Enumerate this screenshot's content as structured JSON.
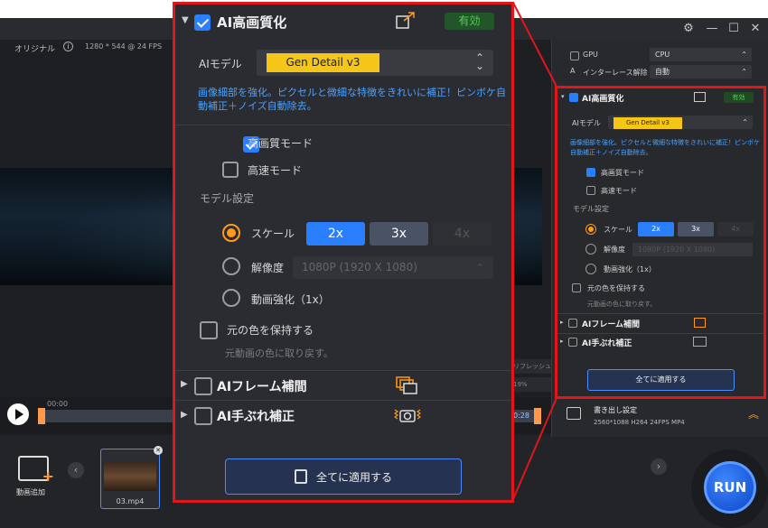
{
  "preview": {
    "original_label": "オリジナル",
    "video_info": "1280 * 544 @ 24 FPS",
    "time_start": "00:00",
    "time_end": "0:28"
  },
  "bottom": {
    "add_video_label": "動画追加",
    "clip_name": "03.mp4",
    "run_label": "RUN"
  },
  "right_panel": {
    "gpu_label": "GPU",
    "gpu_value": "CPU",
    "interlace_label": "インターレース解除",
    "interlace_value": "自動",
    "upscale_title": "AI高画質化",
    "upscale_status": "有効",
    "model_label": "AIモデル",
    "model_value": "Gen Detail v3",
    "description": "画像細部を強化。ピクセルと微細な特徴をきれいに補正！ピンボケ自動補正＋ノイズ自動除去。",
    "hq_mode": "高画質モード",
    "fast_mode": "高速モード",
    "model_settings": "モデル設定",
    "scale_label": "スケール",
    "scale_options": [
      "2x",
      "3x",
      "4x"
    ],
    "resolution_label": "解像度",
    "resolution_value": "1080P (1920 X 1080)",
    "enhance_label": "動画強化（1x）",
    "keep_color_label": "元の色を保持する",
    "keep_color_hint": "元動画の色に取り戻す。",
    "frame_interp": "AIフレーム補間",
    "stabilize": "AI手ぶれ補正",
    "apply_all": "全てに適用する",
    "export_title": "書き出し設定",
    "export_info": "2560*1088  H264  24FPS  MP4"
  },
  "popup": {
    "title": "AI高画質化",
    "status": "有効",
    "model_label": "AIモデル",
    "model_value": "Gen Detail v3",
    "description": "画像細部を強化。ピクセルと微細な特徴をきれいに補正！ピンボケ自動補正＋ノイズ自動除去。",
    "hq_mode": "高画質モード",
    "fast_mode": "高速モード",
    "model_settings": "モデル設定",
    "scale_label": "スケール",
    "scale_2x": "2x",
    "scale_3x": "3x",
    "scale_4x": "4x",
    "resolution_label": "解像度",
    "resolution_value": "1080P (1920 X 1080)",
    "enhance_label": "動画強化（1x）",
    "keep_color_label": "元の色を保持する",
    "keep_color_hint": "元動画の色に取り戻す。",
    "frame_interp": "AIフレーム補間",
    "stabilize": "AI手ぶれ補正",
    "apply_all": "全てに適用する"
  },
  "colors": {
    "accent_blue": "#2a7fff",
    "model_yellow": "#f5c518",
    "status_green": "#4fd14f",
    "radio_orange": "#ff9a1a",
    "highlight_red": "#e0161b"
  }
}
